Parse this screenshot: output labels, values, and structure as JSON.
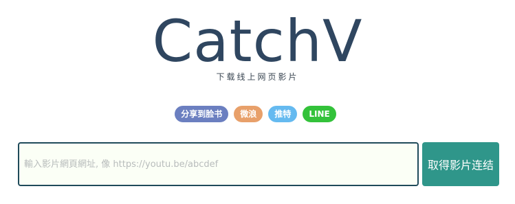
{
  "header": {
    "logo_text": "CatchV",
    "subtitle": "下载线上网页影片"
  },
  "share": {
    "facebook_label": "分享到脸书",
    "weibo_label": "微浪",
    "twitter_label": "推特",
    "line_label": "LINE"
  },
  "search": {
    "placeholder": "輸入影片網頁網址, 像 https://youtu.be/abcdef",
    "value": "",
    "submit_label": "取得影片连结"
  },
  "colors": {
    "logo": "#2f4660",
    "facebook": "#6b7fc0",
    "weibo": "#e8a06a",
    "twitter": "#65baf0",
    "line": "#33c23a",
    "submit": "#2f968a",
    "input_border": "#1f4a5a",
    "input_background": "#fbfff6"
  }
}
